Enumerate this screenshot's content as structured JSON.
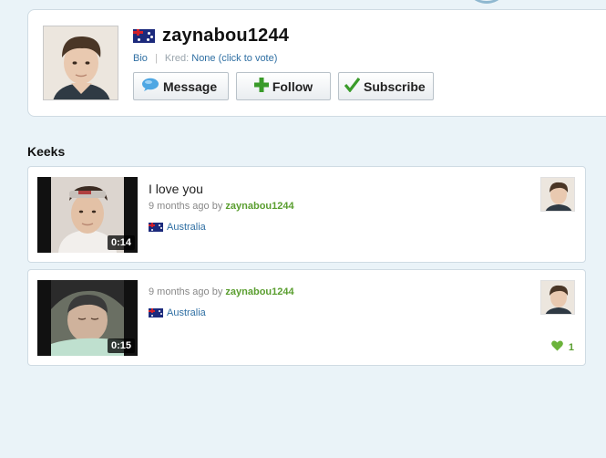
{
  "profile": {
    "username": "zaynabou1244",
    "bio_label": "Bio",
    "kred_label": "Kred:",
    "kred_value": "None (click to vote)",
    "buttons": {
      "message": "Message",
      "follow": "Follow",
      "subscribe": "Subscribe"
    },
    "flag_icon": "australia-flag-icon"
  },
  "keeks_section": {
    "title": "Keeks",
    "items": [
      {
        "caption": "I love you",
        "time_ago": "9 months ago",
        "by": "by",
        "author": "zaynabou1244",
        "location": "Australia",
        "duration": "0:14"
      },
      {
        "caption": "",
        "time_ago": "9 months ago",
        "by": "by",
        "author": "zaynabou1244",
        "location": "Australia",
        "duration": "0:15",
        "likes": "1"
      }
    ]
  },
  "colors": {
    "background": "#eaf3f8",
    "link_blue": "#2f6fa3",
    "user_green": "#5a9e2f",
    "follow_plus_green": "#3a9b2a"
  }
}
